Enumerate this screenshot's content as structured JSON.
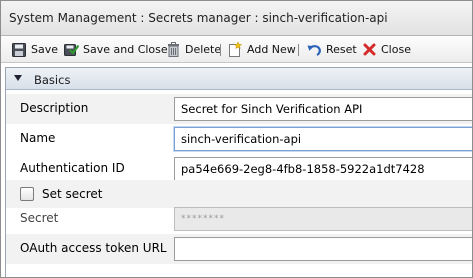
{
  "window": {
    "title": "System Management : Secrets manager : sinch-verification-api"
  },
  "toolbar": {
    "save_label": "Save",
    "save_and_close_label": "Save and Close",
    "delete_label": "Delete",
    "add_new_label": "Add New",
    "reset_label": "Reset",
    "close_label": "Close",
    "icons": {
      "save": "floppy-disk-icon",
      "save_and_close": "save-and-close-icon",
      "delete": "trash-icon",
      "add_new": "new-document-icon",
      "reset": "undo-arrow-icon",
      "close": "red-x-icon"
    }
  },
  "section": {
    "title": "Basics",
    "expanded": true
  },
  "form": {
    "description": {
      "label": "Description",
      "value": "Secret for Sinch Verification API"
    },
    "name": {
      "label": "Name",
      "value": "sinch-verification-api"
    },
    "authentication_id": {
      "label": "Authentication ID",
      "value": "pa54e669-2eg8-4fb8-1858-5922a1dt7428"
    },
    "set_secret": {
      "label": "Set secret",
      "checked": false
    },
    "secret": {
      "label": "Secret",
      "value": "********"
    },
    "oauth_url": {
      "label": "OAuth access token URL",
      "value": ""
    }
  },
  "colors": {
    "section_header": "#dde4ed",
    "row_shade": "#f2f2f2",
    "close_icon": "#d42a2a",
    "reset_icon": "#2a62b8"
  }
}
